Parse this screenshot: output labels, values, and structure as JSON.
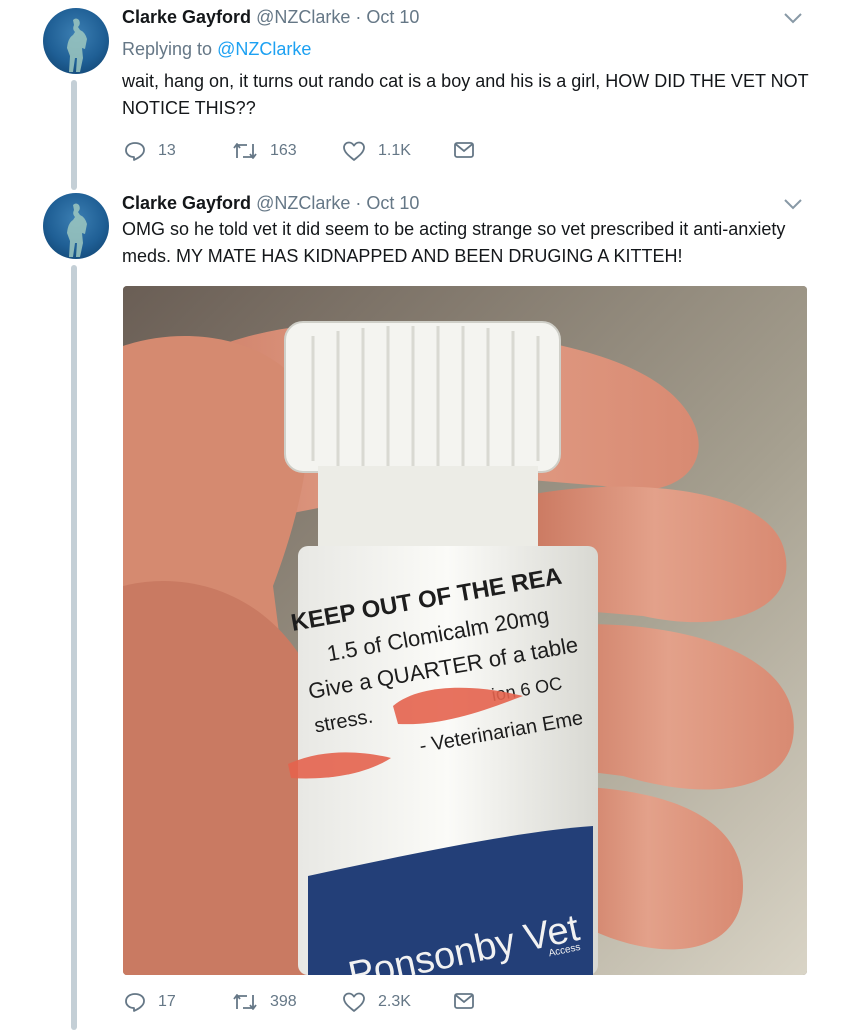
{
  "tweets": [
    {
      "author_name": "Clarke Gayford",
      "handle": "@NZClarke",
      "separator": "·",
      "date": "Oct 10",
      "replying_prefix": "Replying to",
      "replying_handle": "@NZClarke",
      "text": "wait, hang on, it turns out rando cat is a boy and his is a girl, HOW DID THE VET NOT NOTICE THIS??",
      "replies": "13",
      "retweets": "163",
      "likes": "1.1K"
    },
    {
      "author_name": "Clarke Gayford",
      "handle": "@NZClarke",
      "separator": "·",
      "date": "Oct 10",
      "text": "OMG so he told vet it did seem to be acting strange so vet prescribed it anti-anxiety meds. MY MATE HAS KIDNAPPED AND BEEN DRUGING A KITTEH!",
      "replies": "17",
      "retweets": "398",
      "likes": "2.3K",
      "photo": {
        "label_line1": "KEEP OUT OF THE REA",
        "label_line2": "1.5 of Clomicalm 20mg",
        "label_line3": "Give a QUARTER of a table",
        "label_line4": "stress.",
        "label_line4b": "ion 6 OC",
        "label_line5": "- Veterinarian Eme",
        "label_brand": "Ponsonby Vet",
        "label_brand_small": "Access"
      }
    }
  ],
  "colors": {
    "accent": "#1da1f2",
    "muted": "#657786",
    "thread_line": "#c4cfd6"
  },
  "icons": [
    "reply-icon",
    "retweet-icon",
    "like-icon",
    "dm-icon",
    "chevron-down-icon"
  ]
}
